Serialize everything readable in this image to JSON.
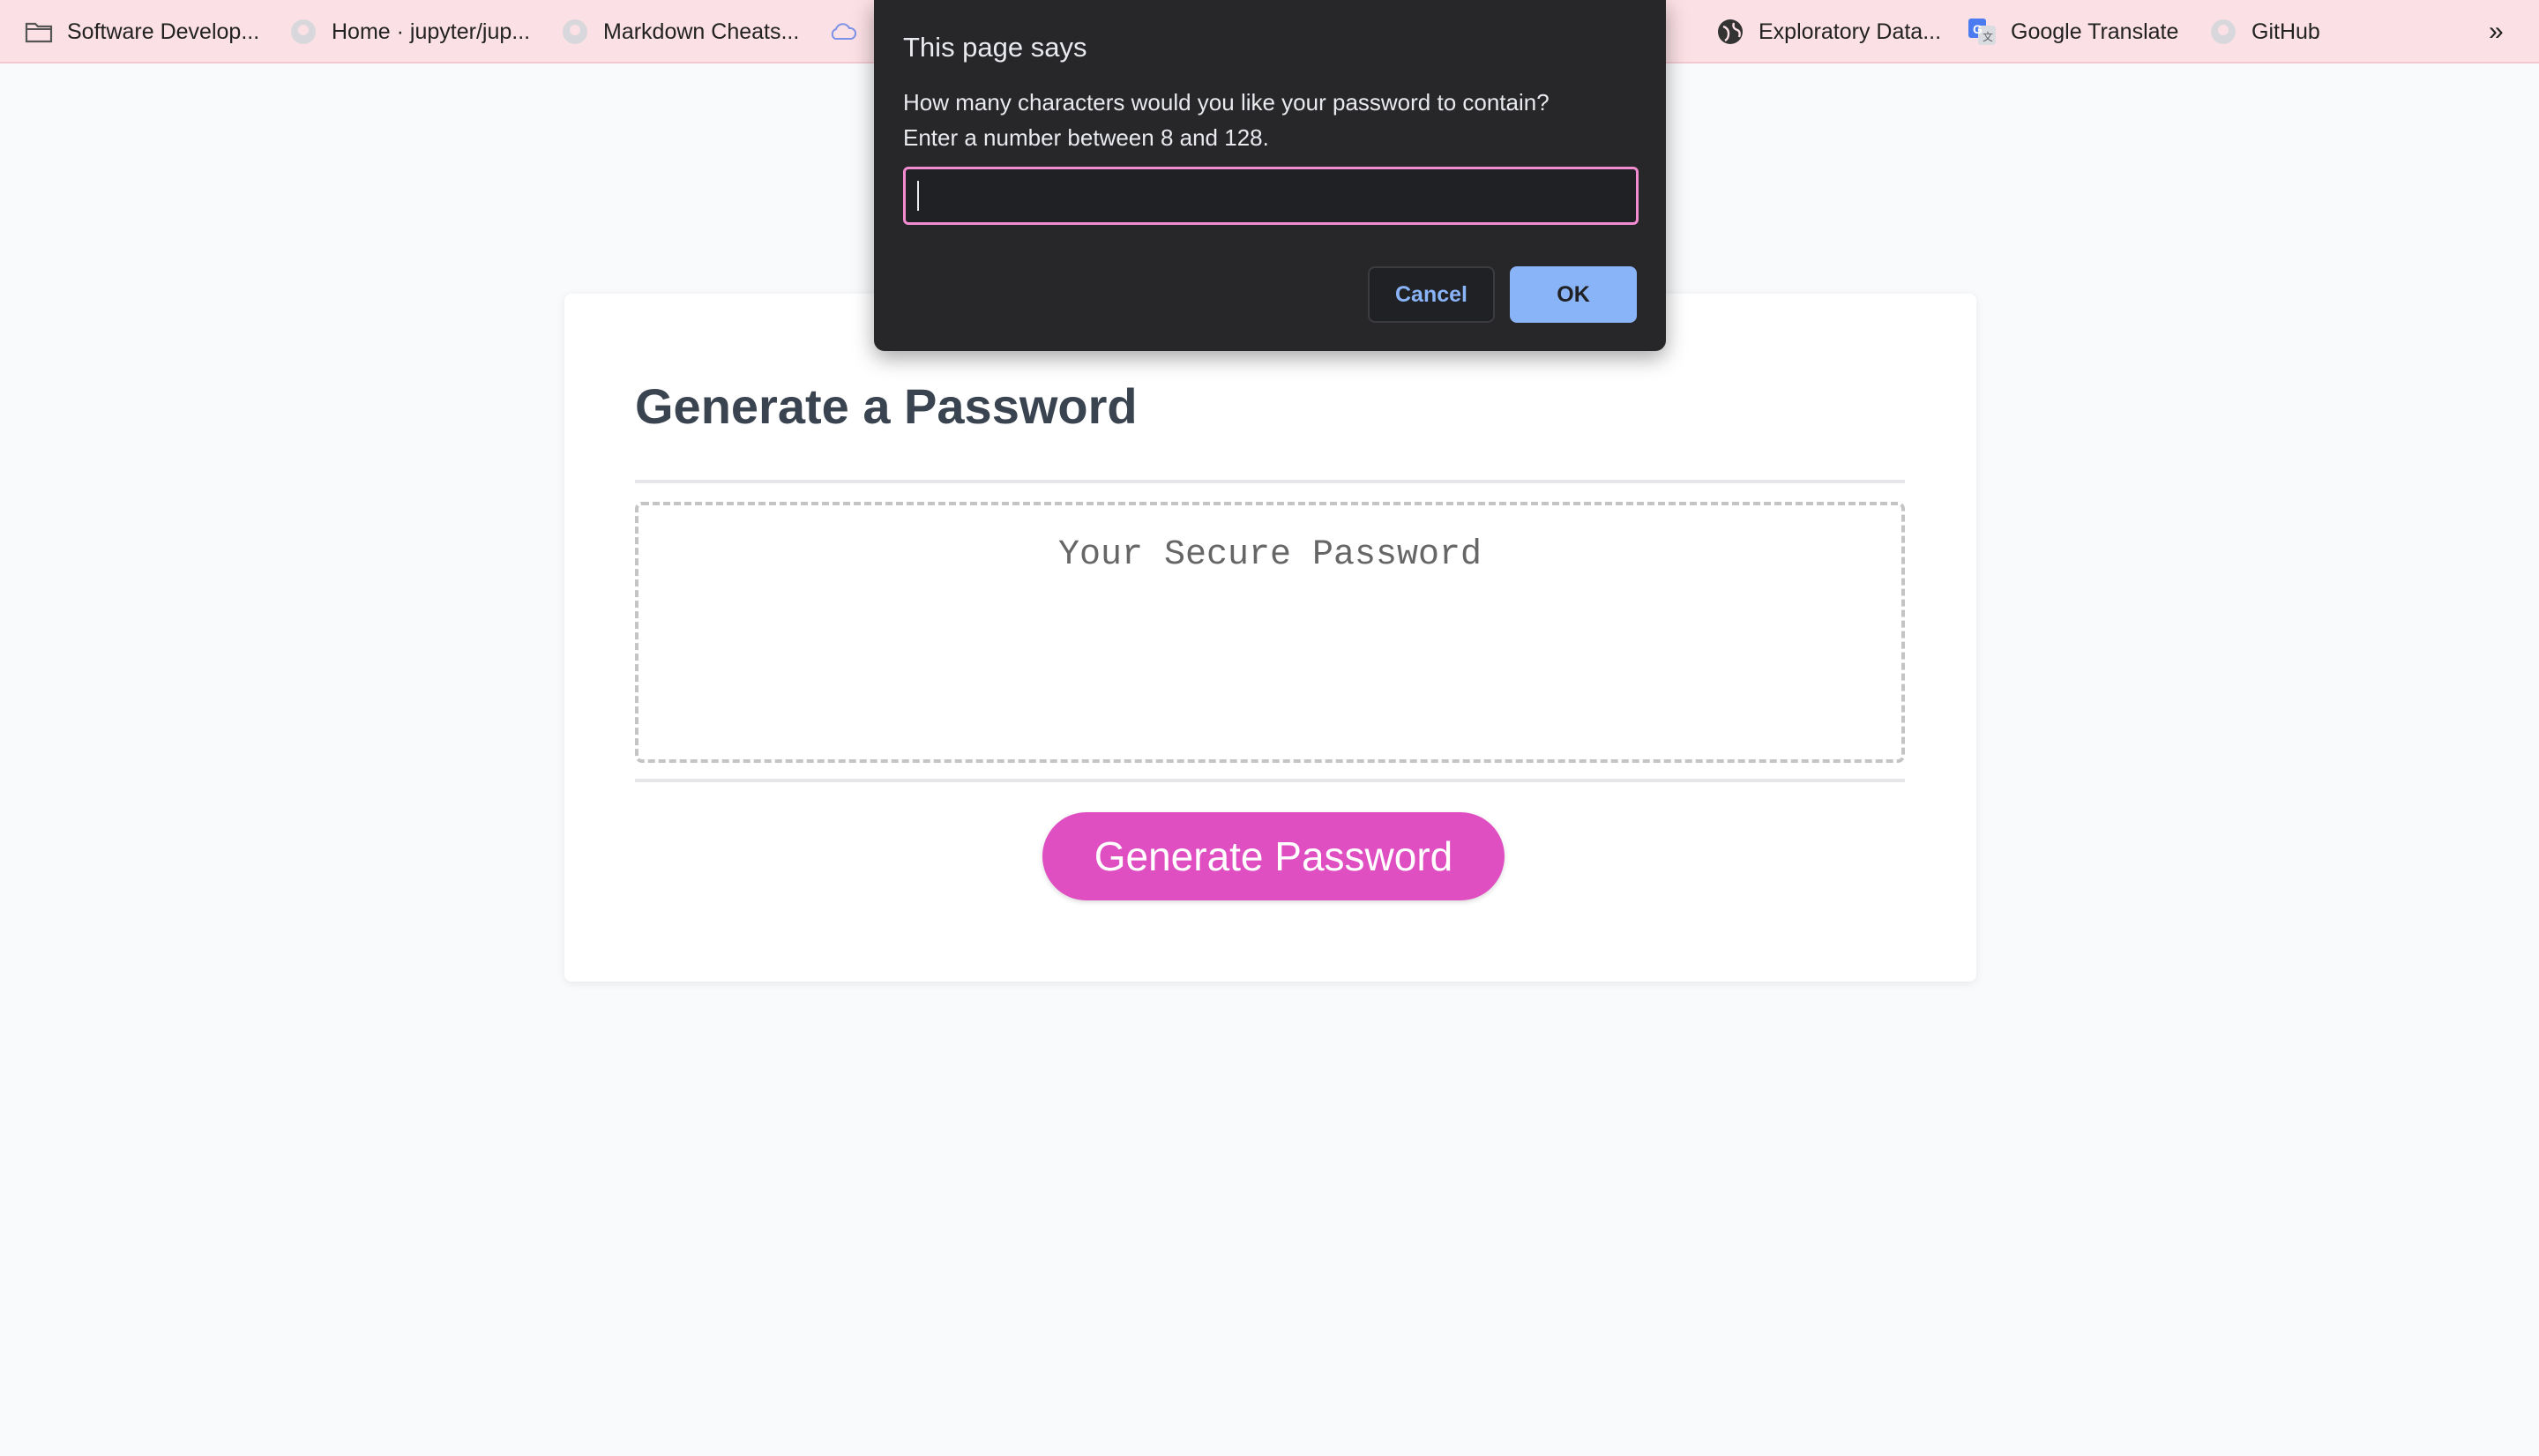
{
  "bookmarks": [
    {
      "label": "Software Develop...",
      "icon": "folder-icon"
    },
    {
      "label": "Home · jupyter/jup...",
      "icon": "github-icon"
    },
    {
      "label": "Markdown Cheats...",
      "icon": "github-icon"
    },
    {
      "label": "",
      "icon": "cloud-icon"
    },
    {
      "label": "...",
      "icon": ""
    },
    {
      "label": "Exploratory Data...",
      "icon": "globe-icon"
    },
    {
      "label": "Google Translate",
      "icon": "google-translate-icon"
    },
    {
      "label": "GitHub",
      "icon": "github-icon"
    }
  ],
  "bookmarks_overflow": "»",
  "dialog": {
    "title": "This page says",
    "message_line1": "How many characters would you like your password to contain?",
    "message_line2": "Enter a number between 8 and 128.",
    "input_value": "",
    "cancel_label": "Cancel",
    "ok_label": "OK"
  },
  "card": {
    "title": "Generate a Password",
    "password_placeholder": "Your Secure Password",
    "generate_label": "Generate Password"
  },
  "colors": {
    "bookmarks_bar": "#fbe0e5",
    "button_accent": "#df4fc1",
    "dialog_bg": "#27272a",
    "dialog_input_border": "#f28bd0",
    "dialog_ok_bg": "#8ab4f8"
  }
}
